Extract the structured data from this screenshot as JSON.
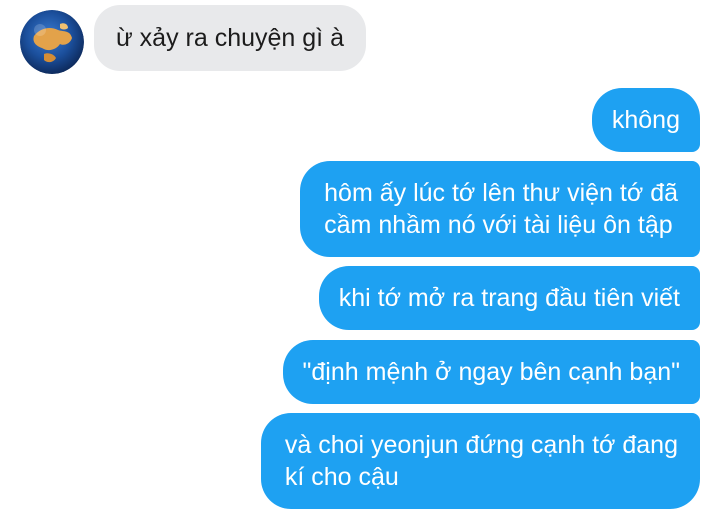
{
  "conversation": {
    "incoming": [
      {
        "text": "ừ xảy ra chuyện gì à"
      }
    ],
    "outgoing": [
      {
        "lines": [
          "không"
        ]
      },
      {
        "lines": [
          "hôm ấy lúc tớ lên thư viện tớ đã",
          "cầm nhầm nó với tài liệu ôn tập"
        ]
      },
      {
        "lines": [
          "khi tớ mở ra trang đầu tiên viết"
        ]
      },
      {
        "lines": [
          "\"định mệnh ở ngay bên cạnh bạn\""
        ]
      },
      {
        "lines": [
          "và choi yeonjun đứng cạnh tớ đang",
          "kí cho cậu"
        ]
      }
    ]
  },
  "colors": {
    "outgoing_bubble": "#1ea1f2",
    "incoming_bubble": "#e8e9eb",
    "background": "#ffffff"
  },
  "icons": {
    "avatar": "globe-avatar"
  }
}
